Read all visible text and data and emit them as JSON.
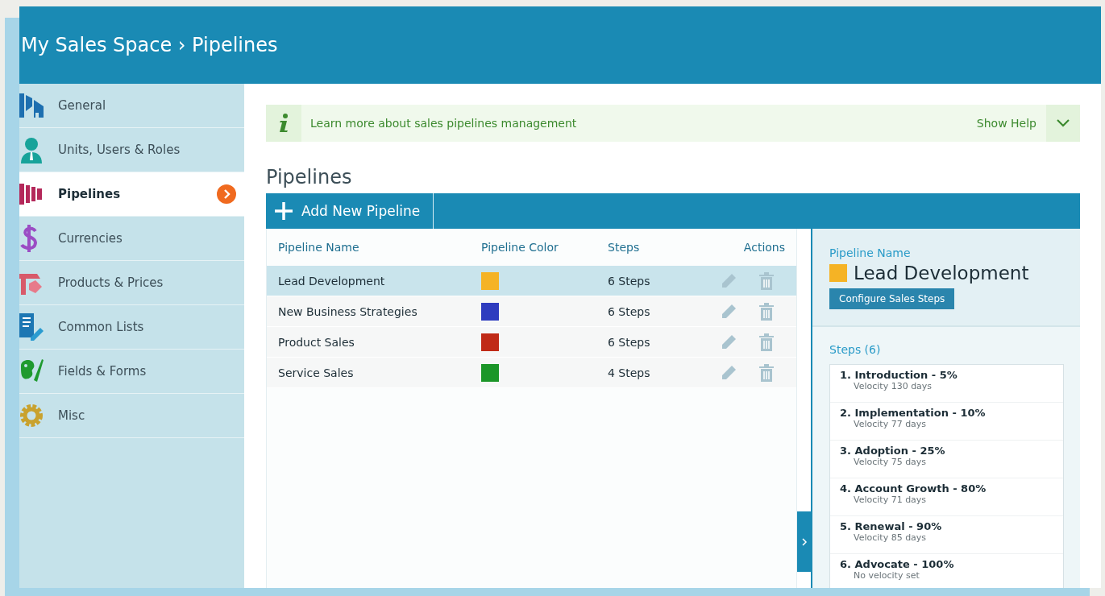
{
  "header": {
    "title": "My Sales Space › Pipelines"
  },
  "sidebar": {
    "items": [
      {
        "label": "General",
        "selected": false
      },
      {
        "label": "Units, Users & Roles",
        "selected": false
      },
      {
        "label": "Pipelines",
        "selected": true
      },
      {
        "label": "Currencies",
        "selected": false
      },
      {
        "label": "Products & Prices",
        "selected": false
      },
      {
        "label": "Common Lists",
        "selected": false
      },
      {
        "label": "Fields & Forms",
        "selected": false
      },
      {
        "label": "Misc",
        "selected": false
      }
    ]
  },
  "help": {
    "text": "Learn more about sales pipelines management",
    "toggle": "Show Help",
    "expanded": false
  },
  "heading": "Pipelines",
  "toolbar": {
    "add_button": "Add New Pipeline"
  },
  "table": {
    "columns": [
      "Pipeline Name",
      "Pipeline Color",
      "Steps",
      "Actions"
    ],
    "rows": [
      {
        "name": "Lead Development",
        "color": "#f5b325",
        "steps": "6 Steps",
        "selected": true
      },
      {
        "name": "New Business Strategies",
        "color": "#2e3cbf",
        "steps": "6 Steps",
        "selected": false
      },
      {
        "name": "Product Sales",
        "color": "#c02a17",
        "steps": "6 Steps",
        "selected": false
      },
      {
        "name": "Service Sales",
        "color": "#1b9628",
        "steps": "4 Steps",
        "selected": false
      }
    ]
  },
  "detail": {
    "label": "Pipeline Name",
    "name": "Lead Development",
    "color": "#f5b325",
    "configure_button": "Configure Sales Steps",
    "steps_title": "Steps (6)",
    "steps": [
      {
        "title": "1. Introduction - 5%",
        "velocity": "Velocity 130 days"
      },
      {
        "title": "2. Implementation - 10%",
        "velocity": "Velocity 77 days"
      },
      {
        "title": "3. Adoption - 25%",
        "velocity": "Velocity 75 days"
      },
      {
        "title": "4. Account Growth - 80%",
        "velocity": "Velocity 71 days"
      },
      {
        "title": "5. Renewal - 90%",
        "velocity": "Velocity 85 days"
      },
      {
        "title": "6. Advocate - 100%",
        "velocity": "No velocity set"
      }
    ]
  }
}
